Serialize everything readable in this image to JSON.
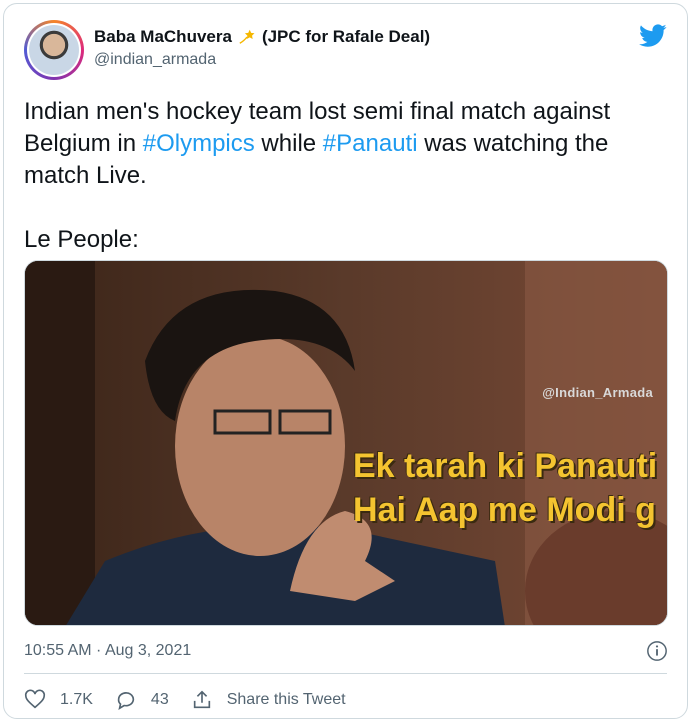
{
  "tweet": {
    "author": {
      "display_name": "Baba MaChuvera",
      "bio_tag": "(JPC for Rafale Deal)",
      "handle": "@indian_armada",
      "badge_icon": "shooting-star-icon"
    },
    "text": {
      "line_intro": "Indian men's hockey team lost semi final match against Belgium in ",
      "hashtag1": "#Olympics",
      "line_mid": " while ",
      "hashtag2": "#Panauti",
      "line_end": " was watching the match Live.",
      "line2": "Le People:"
    },
    "media": {
      "watermark": "@Indian_Armada",
      "caption_line1": "Ek tarah ki Panauti",
      "caption_line2": "Hai Aap me Modi g"
    },
    "timestamp": "10:55 AM · Aug 3, 2021",
    "actions": {
      "likes": "1.7K",
      "replies": "43",
      "share_label": "Share this Tweet"
    },
    "colors": {
      "link": "#1d9bf0",
      "muted": "#536471",
      "caption": "#f4c430"
    }
  }
}
